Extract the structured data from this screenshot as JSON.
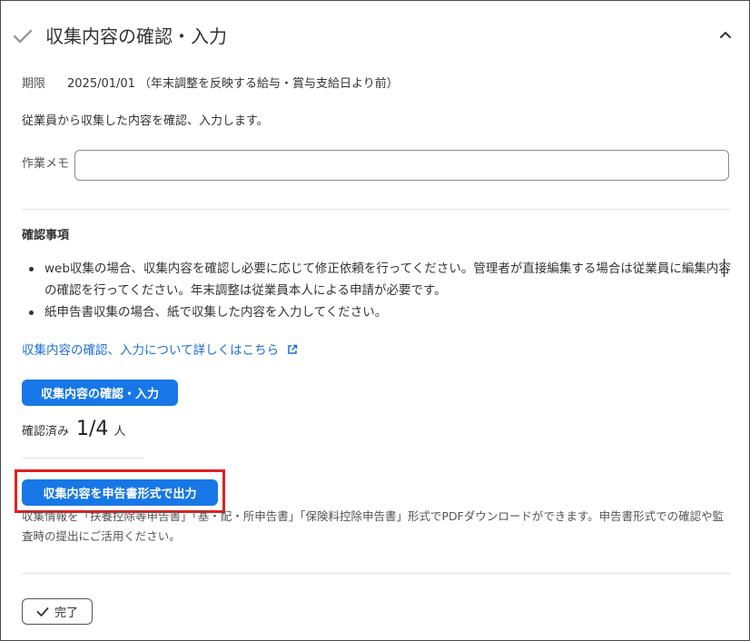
{
  "header": {
    "title": "収集内容の確認・入力",
    "status_icon": "check-icon",
    "collapse_icon": "chevron-up-icon"
  },
  "deadline": {
    "label": "期限",
    "value": "2025/01/01 （年末調整を反映する給与・賞与支給日より前）"
  },
  "description": "従業員から収集した内容を確認、入力します。",
  "memo": {
    "label": "作業メモ",
    "value": "",
    "placeholder": ""
  },
  "checklist": {
    "heading": "確認事項",
    "items": [
      "web収集の場合、収集内容を確認し必要に応じて修正依頼を行ってください。管理者が直接編集する場合は従業員に編集内容の確認を行ってください。年末調整は従業員本人による申請が必要です。",
      "紙申告書収集の場合、紙で収集した内容を入力してください。"
    ]
  },
  "help_link": {
    "text": "収集内容の確認、入力について詳しくはこちら",
    "icon": "external-link-icon"
  },
  "confirm_button_label": "収集内容の確認・入力",
  "confirmed": {
    "label": "確認済み",
    "value": "1/4",
    "unit": "人"
  },
  "export_button_label": "収集内容を申告書形式で出力",
  "export_note": "収集情報を「扶養控除等申告書」「基・配・所申告書」「保険料控除申告書」形式でPDFダウンロードができます。申告書形式での確認や監査時の提出にご活用ください。",
  "done_button_label": "完了",
  "colors": {
    "primary": "#1877e6",
    "link": "#1a6fd6",
    "highlight": "#e02020"
  }
}
